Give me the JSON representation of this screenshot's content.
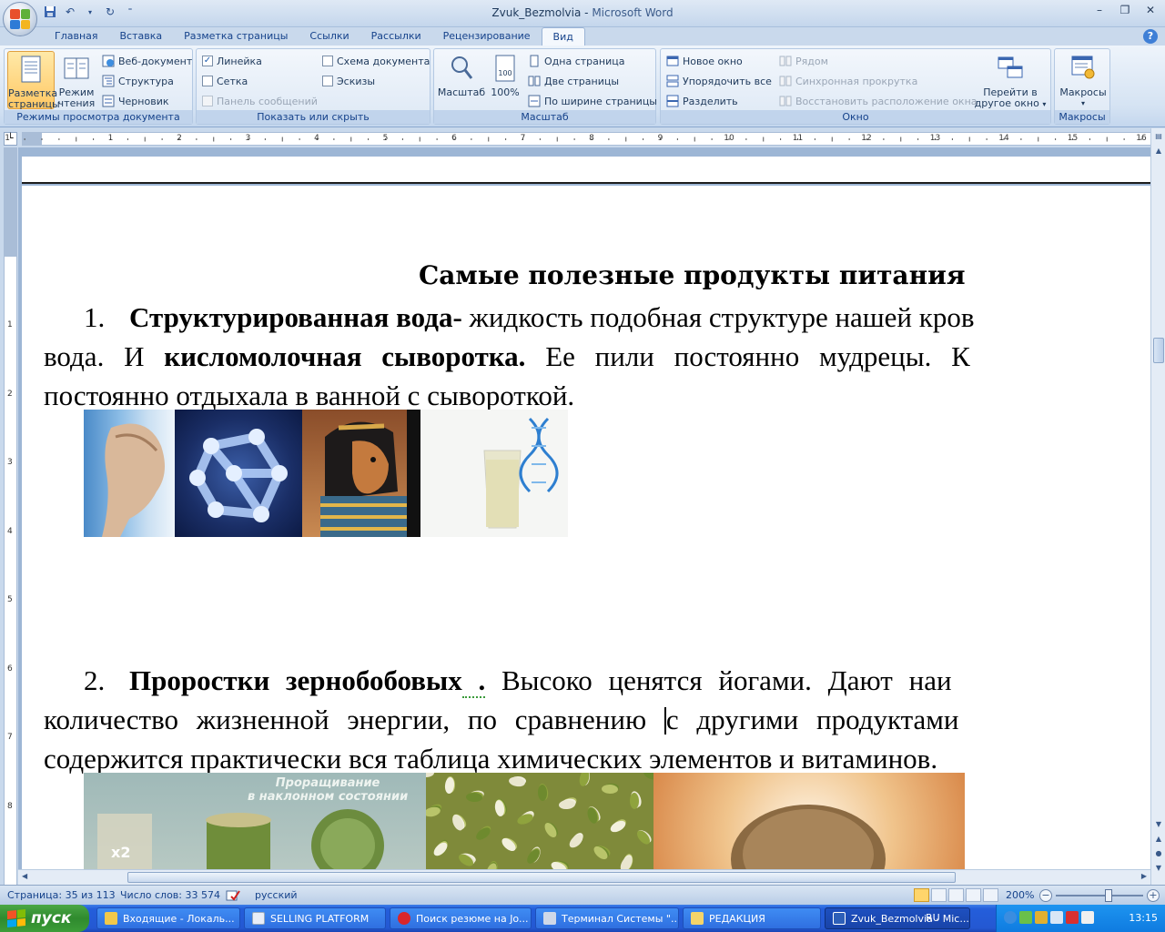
{
  "window": {
    "doc_name": "Zvuk_Bezmolvia",
    "separator": " - ",
    "app_name": "Microsoft Word"
  },
  "quick_access": [
    "save-icon",
    "undo-icon",
    "redo-icon",
    "customize-icon"
  ],
  "tabs": [
    {
      "label": "Главная",
      "active": false
    },
    {
      "label": "Вставка",
      "active": false
    },
    {
      "label": "Разметка страницы",
      "active": false
    },
    {
      "label": "Ссылки",
      "active": false
    },
    {
      "label": "Рассылки",
      "active": false
    },
    {
      "label": "Рецензирование",
      "active": false
    },
    {
      "label": "Вид",
      "active": true
    }
  ],
  "ribbon": {
    "views": {
      "label": "Режимы просмотра документа",
      "print_layout": "Разметка страницы",
      "reading": "Режим чтения",
      "web": "Веб-документ",
      "outline": "Структура",
      "draft": "Черновик"
    },
    "show_hide": {
      "label": "Показать или скрыть",
      "ruler": "Линейка",
      "grid": "Сетка",
      "message_bar": "Панель сообщений",
      "doc_map": "Схема документа",
      "thumbnails": "Эскизы"
    },
    "zoom": {
      "label": "Масштаб",
      "zoom": "Масштаб",
      "percent": "100%",
      "one_page": "Одна страница",
      "two_pages": "Две страницы",
      "page_width": "По ширине страницы"
    },
    "window_group": {
      "label": "Окно",
      "new_window": "Новое окно",
      "arrange_all": "Упорядочить все",
      "split": "Разделить",
      "side_by_side": "Рядом",
      "sync_scroll": "Синхронная прокрутка",
      "reset_pos": "Восстановить расположение окна",
      "switch_line1": "Перейти в",
      "switch_line2": "другое окно"
    },
    "macros": {
      "label": "Макросы",
      "button": "Макросы"
    }
  },
  "document": {
    "title": "Самые полезные продукты питания",
    "p1": {
      "num": "1.",
      "b1": "Структурированная вода-",
      "t1": " жидкость подобная структуре нашей кров",
      "l2a": "вода. И ",
      "b2": "кисломолочная сыворотка.",
      "l2b": " Ее пили постоянно мудрецы. К",
      "l3": "постоянно отдыхала в ванной с сывороткой."
    },
    "p2": {
      "num": "2.",
      "b1": "Проростки зернобобовых",
      "b1s": " .",
      "t1": " Высоко ценятся йогами. Дают наи",
      "l2a": "количество жизненной энергии, по сравнению ",
      "l2b": "с другими продуктами ",
      "l3": "содержится практически вся таблица химических элементов и витаминов."
    },
    "sprout_caption_1": "Проращивание",
    "sprout_caption_2": "в наклонном состоянии",
    "jar_label": "x2"
  },
  "ruler_numbers": [
    "1",
    "1",
    "2",
    "3",
    "4",
    "5",
    "6",
    "7",
    "8",
    "9",
    "10",
    "11",
    "12",
    "13",
    "14",
    "15",
    "16"
  ],
  "vruler_numbers": [
    "1",
    "2",
    "3",
    "4",
    "5",
    "6",
    "7",
    "8"
  ],
  "status": {
    "page": "Страница: 35 из 113",
    "words": "Число слов: 33 574",
    "language": "русский",
    "zoom": "200%"
  },
  "taskbar": {
    "start": "пуск",
    "items": [
      {
        "label": "Входящие - Локаль...",
        "active": false
      },
      {
        "label": "SELLING PLATFORM",
        "active": false
      },
      {
        "label": "Поиск резюме на Jo...",
        "active": false
      },
      {
        "label": "Терминал Системы \"...",
        "active": false
      },
      {
        "label": "РЕДАКЦИЯ",
        "active": false
      },
      {
        "label": "Zvuk_Bezmolvia - Mic...",
        "active": true
      }
    ],
    "lang": "RU",
    "clock": "13:15"
  },
  "colors": {
    "ribbon_text": "#15428b",
    "taskbar": "#245edb",
    "start": "#2f8a2e"
  }
}
